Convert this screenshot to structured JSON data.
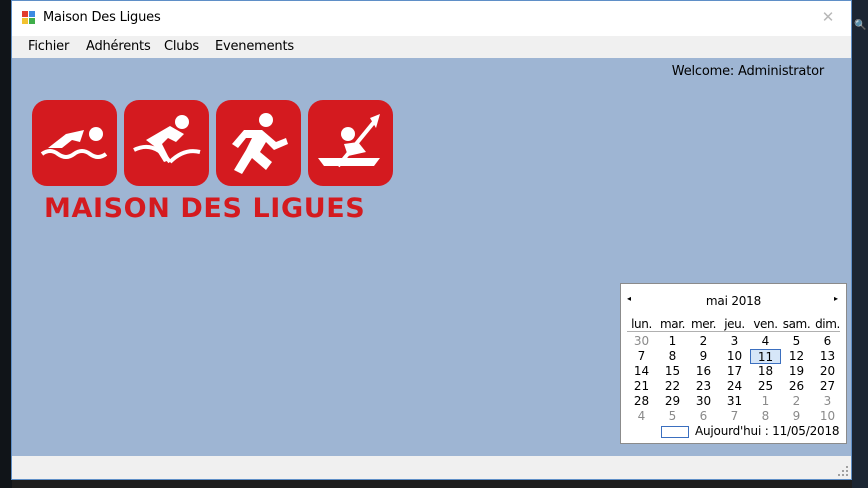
{
  "window": {
    "title": "Maison Des Ligues",
    "close_glyph": "✕"
  },
  "menu": {
    "items": [
      {
        "label": "Fichier"
      },
      {
        "label": "Adhérents"
      },
      {
        "label": "Clubs"
      },
      {
        "label": "Evenements"
      }
    ]
  },
  "main": {
    "welcome": "Welcome: Administrator",
    "logo": {
      "text": "MAISON DES LIGUES",
      "icons": [
        "swimmer-icon",
        "cyclist-icon",
        "runner-icon",
        "kayaker-icon"
      ],
      "brand_color": "#d41a1f"
    }
  },
  "calendar": {
    "prev_glyph": "◂",
    "next_glyph": "▸",
    "month_label": "mai 2018",
    "day_names": [
      "lun.",
      "mar.",
      "mer.",
      "jeu.",
      "ven.",
      "sam.",
      "dim."
    ],
    "weeks": [
      [
        "30",
        "1",
        "2",
        "3",
        "4",
        "5",
        "6"
      ],
      [
        "7",
        "8",
        "9",
        "10",
        "11",
        "12",
        "13"
      ],
      [
        "14",
        "15",
        "16",
        "17",
        "18",
        "19",
        "20"
      ],
      [
        "21",
        "22",
        "23",
        "24",
        "25",
        "26",
        "27"
      ],
      [
        "28",
        "29",
        "30",
        "31",
        "1",
        "2",
        "3"
      ],
      [
        "4",
        "5",
        "6",
        "7",
        "8",
        "9",
        "10"
      ]
    ],
    "selected_day": "11",
    "today_label": "Aujourd'hui : 11/05/2018"
  },
  "colors": {
    "client_background": "#9eb5d3",
    "selection_border": "#3b6fbf"
  }
}
